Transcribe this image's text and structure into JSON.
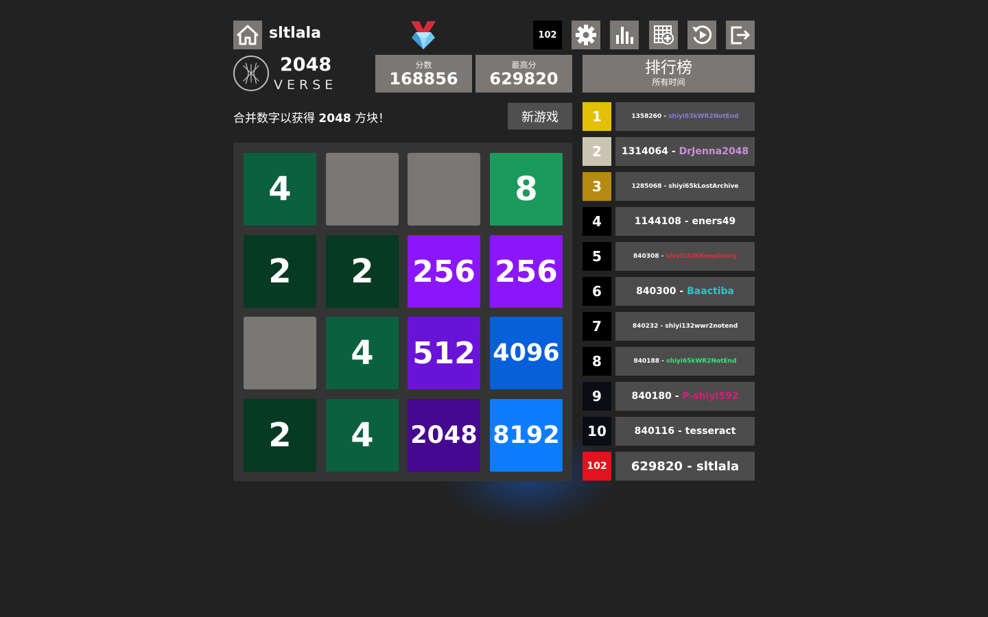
{
  "header": {
    "username": "sltlala",
    "rank_badge": "102"
  },
  "logo": {
    "title": "2048",
    "subtitle": "VERSE"
  },
  "scores": {
    "score_label": "分数",
    "score_value": "168856",
    "best_label": "最高分",
    "best_value": "629820"
  },
  "leaderboard": {
    "title": "排行榜",
    "subtitle": "所有时间",
    "entries": [
      {
        "rank": "1",
        "score": "1358260",
        "name": "shiyi83kWR2NotEnd",
        "rank_bg": "#e5bf06",
        "name_color": "#8a7bd6"
      },
      {
        "rank": "2",
        "score": "1314064",
        "name": "DrJenna2048",
        "rank_bg": "#cac5b1",
        "name_color": "#c98fd6"
      },
      {
        "rank": "3",
        "score": "1285068",
        "name": "shiyi65kLostArchive",
        "rank_bg": "#b58a10",
        "name_color": "#ffffff"
      },
      {
        "rank": "4",
        "score": "1144108",
        "name": "eners49",
        "rank_bg": "#000000",
        "name_color": "#ffffff"
      },
      {
        "rank": "5",
        "score": "840308",
        "name": "shiyi132kKeepGoing",
        "rank_bg": "#000000",
        "name_color": "#e0303a"
      },
      {
        "rank": "6",
        "score": "840300",
        "name": "Baactiba",
        "rank_bg": "#000000",
        "name_color": "#29c7c7"
      },
      {
        "rank": "7",
        "score": "840232",
        "name": "shiyi132wwr2notend",
        "rank_bg": "#000000",
        "name_color": "#ffffff"
      },
      {
        "rank": "8",
        "score": "840188",
        "name": "shiyi65kWR2NotEnd",
        "rank_bg": "#000000",
        "name_color": "#3be07a"
      },
      {
        "rank": "9",
        "score": "840180",
        "name": "P-shiyi592",
        "rank_bg": "#0a0d14",
        "name_color": "#d0207a"
      },
      {
        "rank": "10",
        "score": "840116",
        "name": "tesseract",
        "rank_bg": "#0a0d14",
        "name_color": "#ffffff"
      },
      {
        "rank": "102",
        "score": "629820",
        "name": "sltlala",
        "rank_bg": "#e0131f",
        "name_color": "#ffffff"
      }
    ]
  },
  "game": {
    "tagline_prefix": "合并数字以获得",
    "tagline_target": "2048",
    "tagline_suffix": "方块！",
    "new_game_label": "新游戏",
    "tiles": [
      {
        "value": "4",
        "row": 0,
        "col": 0,
        "color": "#0b6040",
        "row_offset": 0
      },
      {
        "value": "8",
        "row": 0,
        "col": 3,
        "color": "#1b9a5e",
        "row_offset": 0
      },
      {
        "value": "2",
        "row": 1,
        "col": 0,
        "color": "#063a22",
        "row_offset": 0
      },
      {
        "value": "2",
        "row": 1,
        "col": 1,
        "color": "#063a22",
        "row_offset": 0
      },
      {
        "value": "256",
        "row": 1,
        "col": 2,
        "color": "#8b16fb",
        "row_offset": 0
      },
      {
        "value": "256",
        "row": 1,
        "col": 3,
        "color": "#8b16fb",
        "row_offset": 0
      },
      {
        "value": "4",
        "row": 2,
        "col": 1,
        "color": "#0b6040",
        "row_offset": 0
      },
      {
        "value": "512",
        "row": 2,
        "col": 2,
        "color": "#6913d8",
        "row_offset": 0
      },
      {
        "value": "4096",
        "row": 2,
        "col": 3,
        "color": "#0660d9",
        "row_offset": 0
      },
      {
        "value": "2",
        "row": 3,
        "col": 0,
        "color": "#063a22",
        "row_offset": 0
      },
      {
        "value": "4",
        "row": 3,
        "col": 1,
        "color": "#0b6040",
        "row_offset": 0
      },
      {
        "value": "2048",
        "row": 3,
        "col": 2,
        "color": "#44098f",
        "row_offset": 0
      },
      {
        "value": "8192",
        "row": 3,
        "col": 3,
        "color": "#0d7dff",
        "row_offset": 0
      }
    ]
  },
  "icons": [
    "home-icon",
    "gem-medal-icon",
    "settings-icon",
    "stats-icon",
    "new-board-icon",
    "replay-icon",
    "logout-icon",
    "verse-logo-icon"
  ]
}
